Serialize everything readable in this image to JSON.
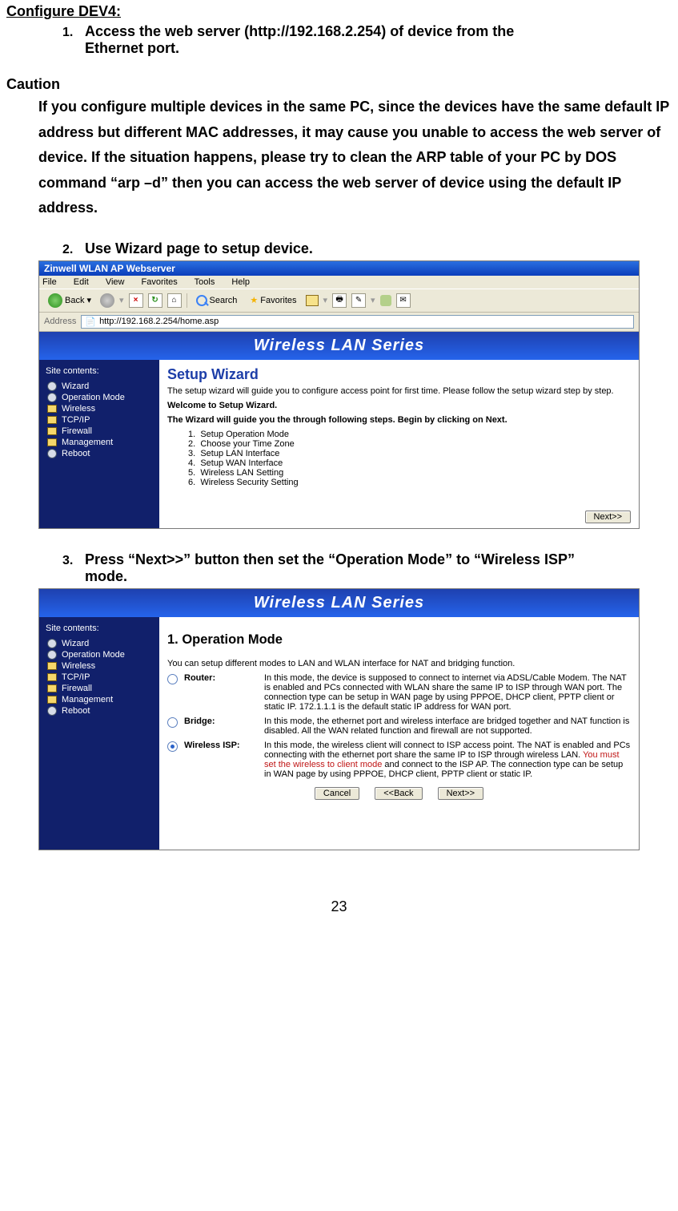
{
  "doc": {
    "title": "Configure DEV4:",
    "step1_line1": "Access the web server (http://192.168.2.254) of device from the",
    "step1_line2": "Ethernet port.",
    "caution_head": "Caution",
    "caution_body": "If you configure multiple devices in the same PC, since the devices have the same default IP address but different MAC addresses, it may cause you unable to access the web server of device. If the situation happens, please try to clean the ARP table of your PC by DOS command “arp –d” then you can access the web server of device using the default IP address.",
    "step2": "Use Wizard page to setup device.",
    "step3_line1": "Press “Next>>” button then set the “Operation Mode” to “Wireless ISP”",
    "step3_line2": "mode.",
    "page_num": "23",
    "num1": "1.",
    "num2": "2.",
    "num3": "3."
  },
  "browser": {
    "window_title": "Zinwell WLAN AP Webserver",
    "menu": {
      "file": "File",
      "edit": "Edit",
      "view": "View",
      "favorites": "Favorites",
      "tools": "Tools",
      "help": "Help"
    },
    "toolbar": {
      "back": "Back",
      "search": "Search",
      "favorites": "Favorites"
    },
    "address_label": "Address",
    "address_url": "http://192.168.2.254/home.asp"
  },
  "banner": "Wireless LAN Series",
  "sidebar": {
    "heading": "Site contents:",
    "items": [
      "Wizard",
      "Operation Mode",
      "Wireless",
      "TCP/IP",
      "Firewall",
      "Management",
      "Reboot"
    ]
  },
  "wizard": {
    "title": "Setup Wizard",
    "intro": "The setup wizard will guide you to configure access point for first time. Please follow the setup wizard step by step.",
    "welcome": "Welcome to Setup Wizard.",
    "guide": "The Wizard will guide you the through following steps. Begin by clicking on Next.",
    "steps_label": [
      "1.",
      "2.",
      "3.",
      "4.",
      "5.",
      "6."
    ],
    "steps": [
      "Setup Operation Mode",
      "Choose your Time Zone",
      "Setup LAN Interface",
      "Setup WAN Interface",
      "Wireless LAN Setting",
      "Wireless Security Setting"
    ],
    "next": "Next>>"
  },
  "opmode": {
    "title": "1. Operation Mode",
    "intro": "You can setup different modes to LAN and WLAN interface for NAT and bridging function.",
    "router": {
      "label": "Router:",
      "desc": "In this mode, the device is supposed to connect to internet via ADSL/Cable Modem. The NAT is enabled and PCs connected with WLAN share the same IP to ISP through WAN port. The connection type can be setup in WAN page by using PPPOE, DHCP client, PPTP client or static IP. 172.1.1.1 is the default static IP address for WAN port."
    },
    "bridge": {
      "label": "Bridge:",
      "desc": "In this mode, the ethernet port and wireless interface are bridged together and NAT function is disabled. All the WAN related function and firewall are not supported."
    },
    "wisp": {
      "label": "Wireless ISP:",
      "desc_a": "In this mode, the wireless client will connect to ISP access point. The NAT is enabled and PCs connecting with the ethernet port share the same IP to ISP through wireless LAN. ",
      "desc_red": "You must set the wireless to client mode",
      "desc_b": " and connect to the ISP AP. The connection type can be setup in WAN page by using PPPOE, DHCP client, PPTP client or static IP."
    },
    "cancel": "Cancel",
    "back": "<<Back",
    "next": "Next>>"
  }
}
